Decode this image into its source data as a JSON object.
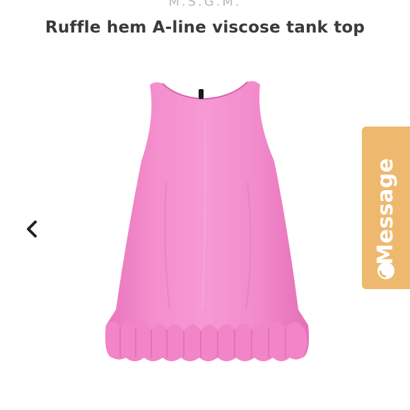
{
  "header": {
    "brand": "M.S.G.M.",
    "title": "Ruffle hem A-line viscose tank top"
  },
  "gallery": {
    "prev_icon": "chevron-left-icon",
    "product_color": "#f287c9"
  },
  "chat": {
    "label": "Message",
    "icon": "chat-bubble-icon",
    "color": "#eeb86e"
  }
}
